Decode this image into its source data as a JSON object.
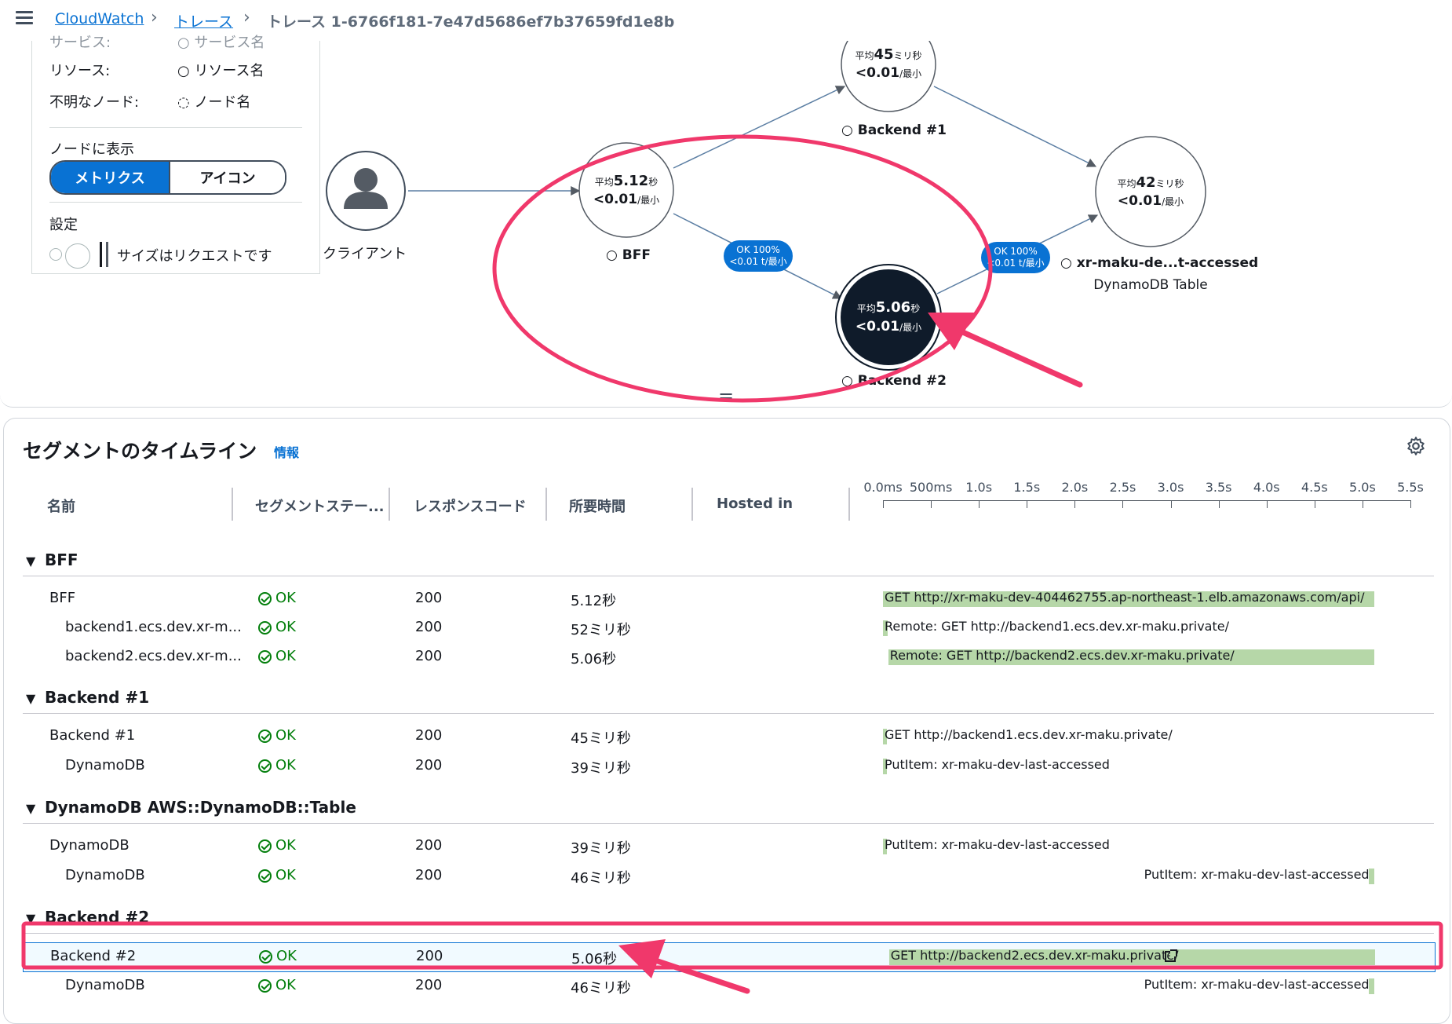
{
  "breadcrumb": {
    "root": "CloudWatch",
    "traces": "トレース",
    "current": "トレース 1-6766f181-7e47d5686ef7b37659fd1e8b"
  },
  "legend": {
    "partial_label": "サービス:",
    "partial_sym": "○ サービス名",
    "resource_label": "リソース:",
    "resource_sym": "○ リソース名",
    "unknown_label": "不明なノード:",
    "unknown_sym": "◌ ノード名",
    "display_heading": "ノードに表示",
    "seg_metrics": "メトリクス",
    "seg_icon": "アイコン",
    "settings_heading": "設定",
    "size_label": "サイズはリクエストです"
  },
  "map": {
    "client_label": "クライアント",
    "nodes": {
      "bff": {
        "avg_prefix": "平均",
        "avg": "5.12",
        "avg_unit": "秒",
        "rate": "<0.01",
        "rate_unit": "/最小",
        "name": "○ BFF"
      },
      "backend1": {
        "avg_prefix": "平均",
        "avg": "45",
        "avg_unit": "ミリ秒",
        "rate": "<0.01",
        "rate_unit": "/最小",
        "name": "○ Backend #1"
      },
      "backend2": {
        "avg_prefix": "平均",
        "avg": "5.06",
        "avg_unit": "秒",
        "rate": "<0.01",
        "rate_unit": "/最小",
        "name": "○ Backend #2"
      },
      "dynamo": {
        "avg_prefix": "平均",
        "avg": "42",
        "avg_unit": "ミリ秒",
        "rate": "<0.01",
        "rate_unit": "/最小",
        "name": "○ xr-maku-de...t-accessed",
        "sub": "DynamoDB Table"
      }
    },
    "edge_badges": [
      {
        "line1": "OK 100%",
        "line2": "<0.01 t/最小"
      },
      {
        "line1": "OK 100%",
        "line2": "<0.01 t/最小"
      }
    ],
    "handle": "="
  },
  "timeline": {
    "title": "セグメントのタイムライン",
    "info": "情報",
    "headers": [
      "名前",
      "セグメントステー...",
      "レスポンスコード",
      "所要時間",
      "Hosted in"
    ],
    "ticks": [
      "0.0ms",
      "500ms",
      "1.0s",
      "1.5s",
      "2.0s",
      "2.5s",
      "3.0s",
      "3.5s",
      "4.0s",
      "4.5s",
      "5.0s",
      "5.5s"
    ],
    "groups": [
      {
        "title": "BFF",
        "rows": [
          {
            "name": "BFF",
            "status": "OK",
            "code": "200",
            "duration": "5.12秒",
            "bar_start": 0.0,
            "bar_end": 5.12,
            "label": "GET http://xr-maku-dev-404462755.ap-northeast-1.elb.amazonaws.com/api/"
          },
          {
            "name": "backend1.ecs.dev.xr-m...",
            "status": "OK",
            "code": "200",
            "duration": "52ミリ秒",
            "bar_start": 0.0,
            "bar_end": 0.052,
            "label": "Remote: GET http://backend1.ecs.dev.xr-maku.private/"
          },
          {
            "name": "backend2.ecs.dev.xr-m...",
            "status": "OK",
            "code": "200",
            "duration": "5.06秒",
            "bar_start": 0.055,
            "bar_end": 5.12,
            "label": "Remote: GET http://backend2.ecs.dev.xr-maku.private/"
          }
        ]
      },
      {
        "title": "Backend #1",
        "rows": [
          {
            "name": "Backend #1",
            "status": "OK",
            "code": "200",
            "duration": "45ミリ秒",
            "bar_start": 0.0,
            "bar_end": 0.045,
            "label": "GET http://backend1.ecs.dev.xr-maku.private/"
          },
          {
            "name": "DynamoDB",
            "status": "OK",
            "code": "200",
            "duration": "39ミリ秒",
            "bar_start": 0.0,
            "bar_end": 0.039,
            "label": "PutItem: xr-maku-dev-last-accessed"
          }
        ]
      },
      {
        "title": "DynamoDB   AWS::DynamoDB::Table",
        "rows": [
          {
            "name": "DynamoDB",
            "status": "OK",
            "code": "200",
            "duration": "39ミリ秒",
            "bar_start": 0.0,
            "bar_end": 0.039,
            "label": "PutItem: xr-maku-dev-last-accessed"
          },
          {
            "name": "DynamoDB",
            "status": "OK",
            "code": "200",
            "duration": "46ミリ秒",
            "bar_start": 5.07,
            "bar_end": 5.12,
            "label": "PutItem: xr-maku-dev-last-accessed"
          }
        ]
      },
      {
        "title": "Backend #2",
        "rows": [
          {
            "name": "Backend #2",
            "status": "OK",
            "code": "200",
            "duration": "5.06秒",
            "bar_start": 0.055,
            "bar_end": 5.12,
            "label": "GET http://backend2.ecs.dev.xr-maku.private/",
            "selected": true
          },
          {
            "name": "DynamoDB",
            "status": "OK",
            "code": "200",
            "duration": "46ミリ秒",
            "bar_start": 5.07,
            "bar_end": 5.12,
            "label": "PutItem: xr-maku-dev-last-accessed"
          }
        ]
      }
    ]
  },
  "colors": {
    "link": "#0972d3",
    "ok_green": "#037f0c",
    "bar_green": "#b6d7a8",
    "annotation_pink": "#f0386b",
    "node_selected": "#0f1b2a"
  }
}
